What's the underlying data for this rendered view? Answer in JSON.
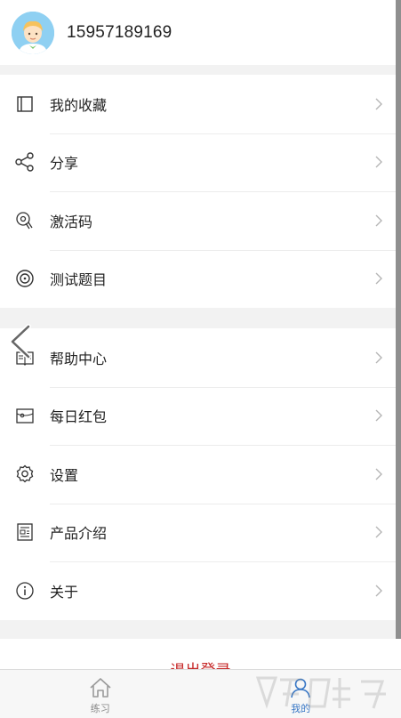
{
  "profile": {
    "phone": "15957189169"
  },
  "menu_group_1": [
    {
      "label": "我的收藏",
      "icon": "bookmark-icon"
    },
    {
      "label": "分享",
      "icon": "share-icon"
    },
    {
      "label": "激活码",
      "icon": "activation-icon"
    },
    {
      "label": "测试题目",
      "icon": "test-icon"
    }
  ],
  "menu_group_2": [
    {
      "label": "帮助中心",
      "icon": "help-book-icon"
    },
    {
      "label": "每日红包",
      "icon": "red-packet-icon"
    },
    {
      "label": "设置",
      "icon": "gear-icon"
    },
    {
      "label": "产品介绍",
      "icon": "product-icon"
    },
    {
      "label": "关于",
      "icon": "info-icon"
    }
  ],
  "logout_label": "退出登录",
  "tabbar": [
    {
      "label": "练习",
      "icon": "home-icon",
      "active": false
    },
    {
      "label": "我的",
      "icon": "user-icon",
      "active": true
    }
  ],
  "colors": {
    "logout": "#c62828",
    "tab_active": "#3a78c6",
    "tab_inactive": "#8a8a8a"
  }
}
